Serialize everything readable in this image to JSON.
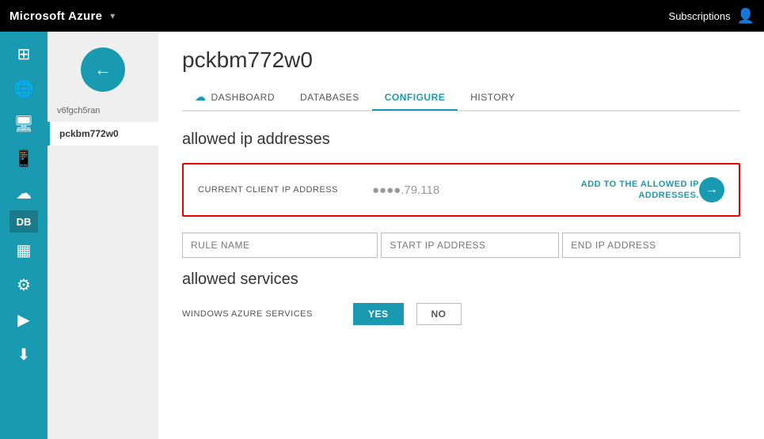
{
  "topbar": {
    "logo": "Microsoft Azure",
    "chevron": "▾",
    "subscriptions_label": "Subscriptions"
  },
  "sidebar": {
    "icons": [
      {
        "name": "grid-icon",
        "symbol": "⊞"
      },
      {
        "name": "globe-icon",
        "symbol": "🌐"
      },
      {
        "name": "monitor-icon",
        "symbol": "🖥"
      },
      {
        "name": "tablet-icon",
        "symbol": "📱"
      },
      {
        "name": "cloud-icon",
        "symbol": "☁"
      },
      {
        "name": "database-icon",
        "symbol": "DB"
      },
      {
        "name": "table-icon",
        "symbol": "▦"
      },
      {
        "name": "integration-icon",
        "symbol": "⚙"
      },
      {
        "name": "media-icon",
        "symbol": "▶"
      },
      {
        "name": "download-icon",
        "symbol": "⬇"
      }
    ]
  },
  "account_nav": {
    "header": "v6fgch5ran",
    "active_item": "pckbm772w0"
  },
  "content": {
    "title": "pckbm772w0",
    "tabs": [
      {
        "label": "DASHBOARD",
        "icon": "☁",
        "active": false
      },
      {
        "label": "DATABASES",
        "icon": "",
        "active": false
      },
      {
        "label": "CONFIGURE",
        "icon": "",
        "active": true
      },
      {
        "label": "HISTORY",
        "icon": "",
        "active": false
      }
    ],
    "allowed_ip": {
      "section_title": "allowed ip addresses",
      "box": {
        "label": "CURRENT CLIENT IP ADDRESS",
        "value": "●●●●.79.118",
        "action": "ADD TO THE ALLOWED IP ADDRESSES.",
        "arrow": "→"
      },
      "rule_row": {
        "rule_name_placeholder": "RULE NAME",
        "start_ip_placeholder": "START IP ADDRESS",
        "end_ip_placeholder": "END IP ADDRESS"
      }
    },
    "allowed_services": {
      "section_title": "allowed services",
      "row": {
        "label": "WINDOWS AZURE SERVICES",
        "yes_label": "YES",
        "no_label": "NO"
      }
    }
  }
}
